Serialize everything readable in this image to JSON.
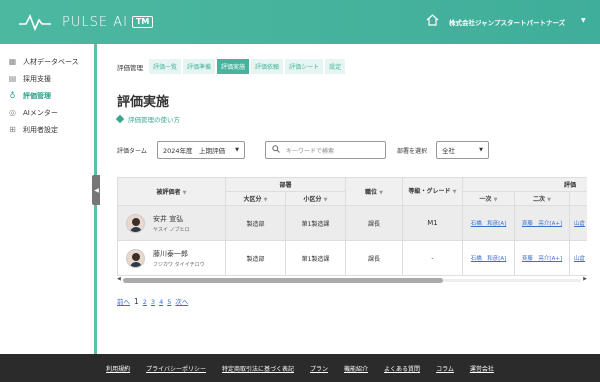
{
  "header": {
    "logo_text": "PULSE AI",
    "logo_tm": "TM",
    "company": "株式会社ジャンプスタートパートナーズ",
    "icons": {
      "home": "home-icon",
      "caret": "chevron-down-icon"
    }
  },
  "sidebar": {
    "items": [
      {
        "label": "人材データベース",
        "icon": "database-icon"
      },
      {
        "label": "採用支援",
        "icon": "document-icon"
      },
      {
        "label": "評価管理",
        "icon": "lightbulb-icon",
        "active": true
      },
      {
        "label": "AIメンター",
        "icon": "chat-icon"
      },
      {
        "label": "利用者設定",
        "icon": "users-icon"
      }
    ]
  },
  "tabs": {
    "label": "評価管理",
    "items": [
      "評価一覧",
      "評価準備",
      "評価実施",
      "評価依頼",
      "評価シート",
      "設定"
    ],
    "active_index": 2
  },
  "page": {
    "title": "評価実施",
    "help_link": "評価管理の使い方"
  },
  "filters": {
    "term_label": "評価ターム",
    "term_value": "2024年度　上期評価",
    "search_placeholder": "キーワードで検索",
    "dept_label": "部署を選択",
    "dept_value": "全社"
  },
  "table": {
    "headers": {
      "evaluatee": "被評価者",
      "dept": "部署",
      "major": "大区分",
      "minor": "小区分",
      "position": "職位",
      "grade": "等級・グレード",
      "eval": "評価",
      "first": "一次",
      "second": "二次",
      "sort_icon": "▼"
    },
    "rows": [
      {
        "name": "安井 宣弘",
        "kana": "ヤスイ ノブヒロ",
        "major": "製造部",
        "minor": "第1製造課",
        "position": "課長",
        "grade": "M1",
        "first": "石橋　和彦[A]",
        "second": "斉藤　亮介[A+]",
        "third": "山倉"
      },
      {
        "name": "藤川泰一郎",
        "kana": "フジカワ タイイチロウ",
        "major": "製造部",
        "minor": "第1製造課",
        "position": "課長",
        "grade": "-",
        "first": "石橋　和彦[A]",
        "second": "斉藤　亮介[A+]",
        "third": "山倉"
      }
    ]
  },
  "pager": {
    "prev": "前へ",
    "current": "1",
    "pages": [
      "2",
      "3",
      "4",
      "5"
    ],
    "next": "次へ"
  },
  "footer": {
    "links": [
      "利用規約",
      "プライバシーポリシー",
      "特定商取引法に基づく表記",
      "プラン",
      "機能紹介",
      "よくある質問",
      "コラム",
      "運営会社"
    ]
  },
  "colors": {
    "accent": "#48b39c",
    "link": "#3b6fd1",
    "footer": "#2b2b2b"
  }
}
